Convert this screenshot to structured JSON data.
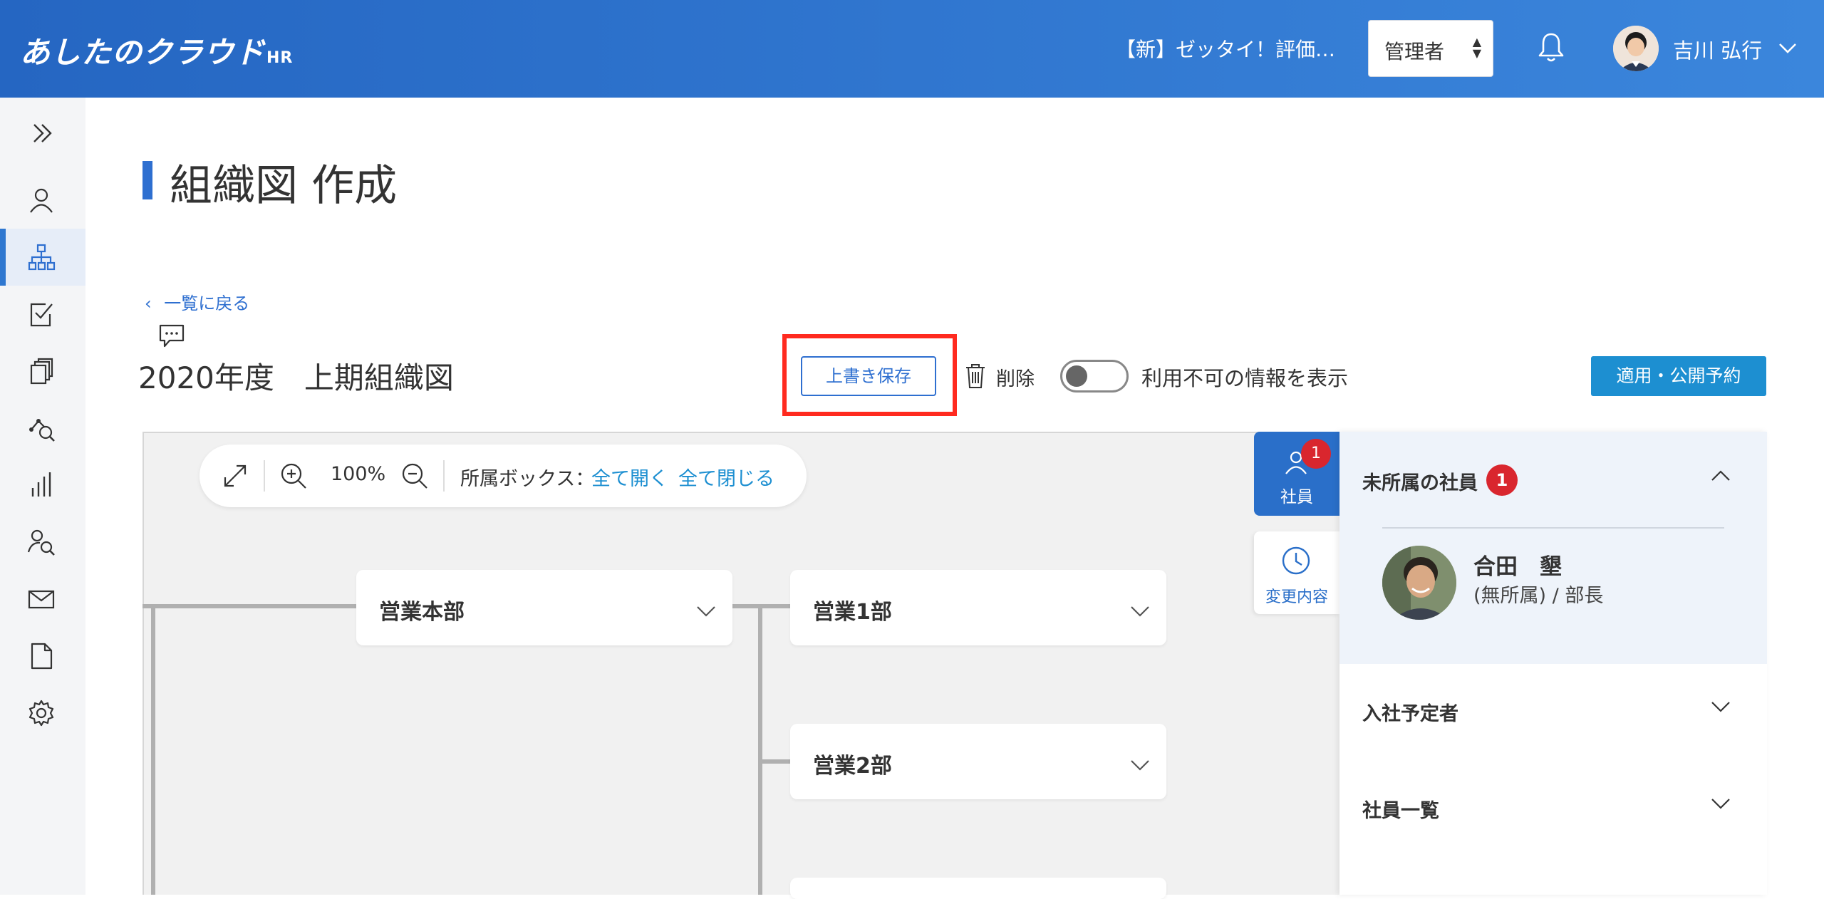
{
  "header": {
    "logo": "あしたのクラウド",
    "logo_suffix": "HR",
    "company": "【新】ゼッタイ！評価…",
    "role_select": "管理者",
    "username": "吉川 弘行"
  },
  "sidebar": {
    "items": [
      {
        "icon": "user-icon"
      },
      {
        "icon": "org-chart-icon",
        "active": true
      },
      {
        "icon": "checklist-icon"
      },
      {
        "icon": "documents-icon"
      },
      {
        "icon": "analysis-icon"
      },
      {
        "icon": "bar-chart-icon"
      },
      {
        "icon": "user-search-icon"
      },
      {
        "icon": "mail-icon"
      },
      {
        "icon": "file-icon"
      },
      {
        "icon": "gear-icon"
      }
    ]
  },
  "page": {
    "title": "組織図 作成",
    "back_link": "一覧に戻る",
    "org_name": "2020年度　上期組織図",
    "save_button": "上書き保存",
    "delete_label": "削除",
    "toggle_label": "利用不可の情報を表示",
    "toggle_on": false,
    "publish_button": "適用・公開予約"
  },
  "toolbar": {
    "zoom": "100%",
    "box_label": "所属ボックス：",
    "expand_all": "全て開く",
    "collapse_all": "全て閉じる"
  },
  "org_chart": {
    "nodes": [
      {
        "name": "営業本部"
      },
      {
        "name": "営業1部"
      },
      {
        "name": "営業2部"
      }
    ]
  },
  "right_panel": {
    "tab_employees": "社員",
    "tab_employees_badge": "1",
    "tab_changes": "変更内容",
    "sections": [
      {
        "title": "未所属の社員",
        "badge": "1",
        "expanded": true
      },
      {
        "title": "入社予定者",
        "expanded": false
      },
      {
        "title": "社員一覧",
        "expanded": false
      }
    ],
    "unassigned_employee": {
      "name": "合田　墾",
      "role": "(無所属) / 部長"
    }
  },
  "colors": {
    "header_start": "#2566c2",
    "header_end": "#3b86dc",
    "accent_blue": "#2e6fd0",
    "publish_button": "#1d8fd1",
    "badge_red": "#d9262e",
    "highlight_red": "#ff2a1f"
  }
}
